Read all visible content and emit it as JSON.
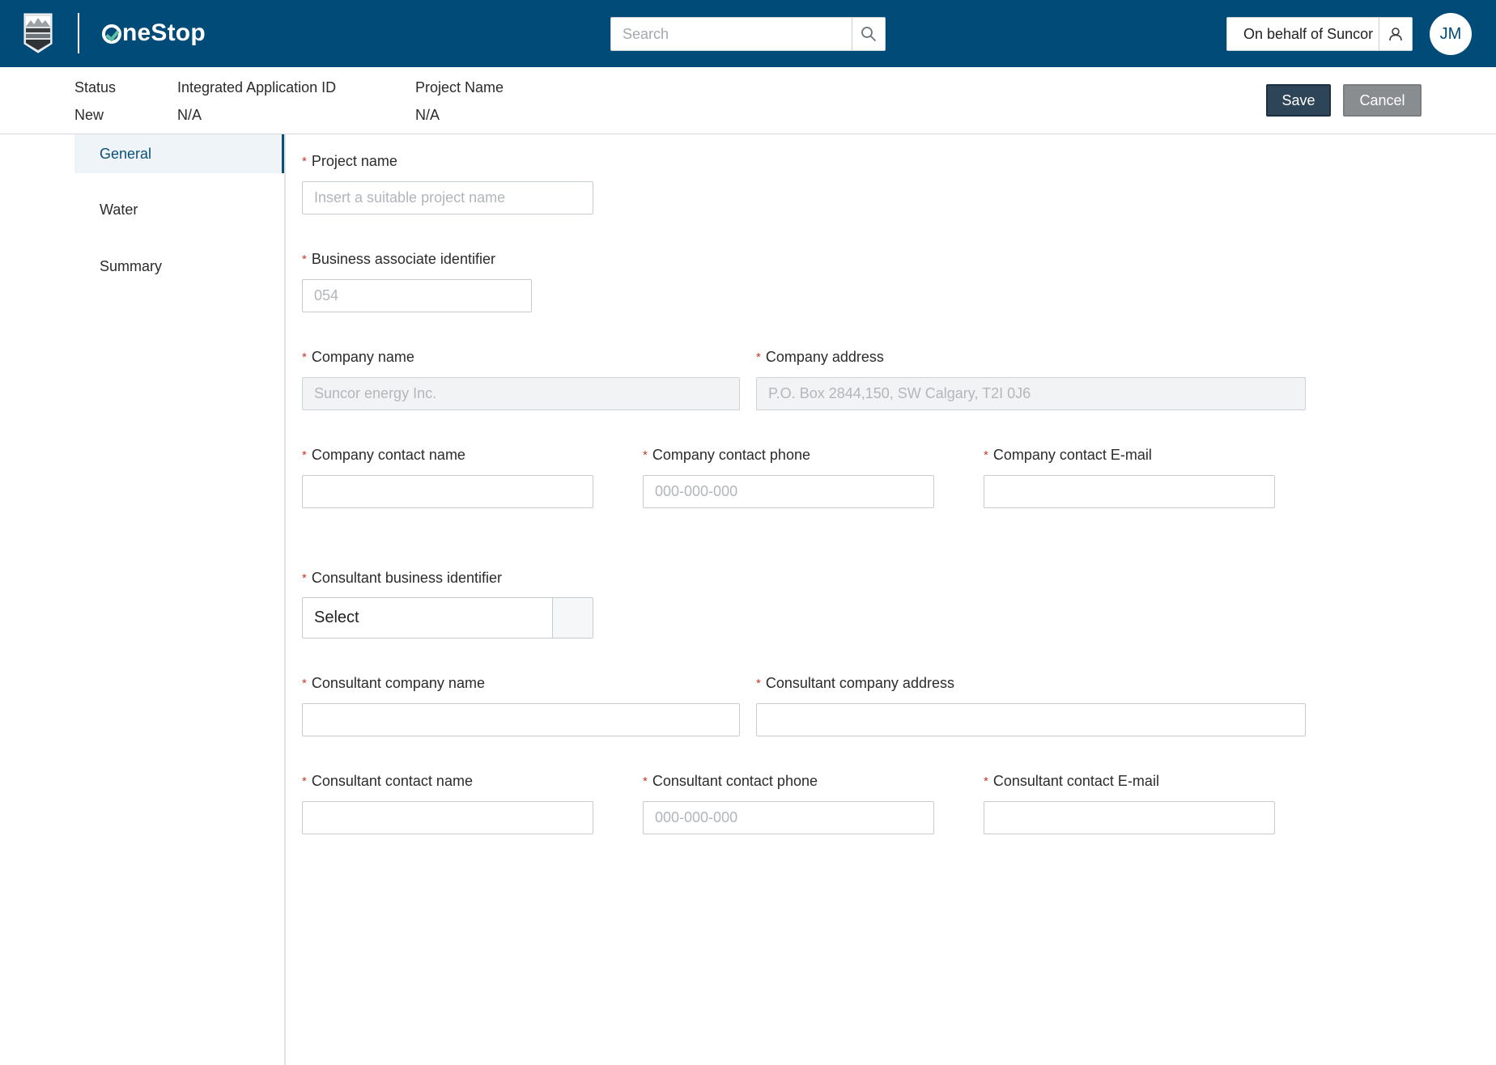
{
  "header": {
    "brand": "OneStop",
    "brand_rest": "neStop",
    "search": {
      "placeholder": "Search"
    },
    "behalf_label": "On behalf of Suncor",
    "avatar_initials": "JM"
  },
  "subheader": {
    "status": {
      "label": "Status",
      "value": "New"
    },
    "app_id": {
      "label": "Integrated Application ID",
      "value": "N/A"
    },
    "project": {
      "label": "Project Name",
      "value": "N/A"
    },
    "save_label": "Save",
    "cancel_label": "Cancel"
  },
  "sidebar": {
    "items": [
      {
        "label": "General",
        "active": true
      },
      {
        "label": "Water",
        "active": false
      },
      {
        "label": "Summary",
        "active": false
      }
    ]
  },
  "form": {
    "required_mark": "*",
    "project_name": {
      "label": "Project name",
      "placeholder": "Insert a suitable project name",
      "value": ""
    },
    "ba_identifier": {
      "label": "Business associate identifier",
      "placeholder": "054",
      "value": ""
    },
    "company_name": {
      "label": "Company name",
      "placeholder": "Suncor energy Inc."
    },
    "company_address": {
      "label": "Company address",
      "placeholder": "P.O. Box 2844,150, SW Calgary, T2I 0J6"
    },
    "company_contact_name": {
      "label": "Company contact name",
      "placeholder": ""
    },
    "company_contact_phone": {
      "label": "Company contact phone",
      "placeholder": "000-000-000"
    },
    "company_contact_email": {
      "label": "Company contact E-mail",
      "placeholder": ""
    },
    "consultant_business_identifier": {
      "label": "Consultant business identifier",
      "selected": "Select"
    },
    "consultant_company_name": {
      "label": "Consultant company name",
      "placeholder": ""
    },
    "consultant_company_address": {
      "label": "Consultant company address",
      "placeholder": ""
    },
    "consultant_contact_name": {
      "label": "Consultant contact name",
      "placeholder": ""
    },
    "consultant_contact_phone": {
      "label": "Consultant contact phone",
      "placeholder": "000-000-000"
    },
    "consultant_contact_email": {
      "label": "Consultant contact E-mail",
      "placeholder": ""
    }
  },
  "colors": {
    "header_bg": "#004b78",
    "accent": "#0b4f78",
    "save_bg": "#2e4558",
    "cancel_bg": "#8a8d8f",
    "required": "#c0392b"
  }
}
